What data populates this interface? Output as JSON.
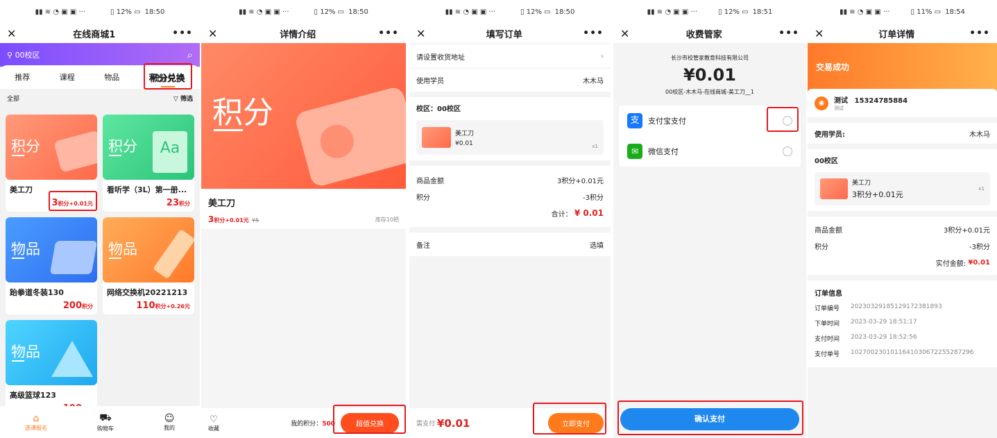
{
  "status": {
    "time1": "18:50",
    "time2": "18:50",
    "time3": "18:50",
    "time4": "18:51",
    "time5": "18:54",
    "battery1": "12%",
    "battery2": "12%",
    "battery3": "12%",
    "battery4": "12%",
    "battery5": "11%"
  },
  "s1": {
    "title": "在线商城1",
    "campus": "00校区",
    "tabs": [
      "推荐",
      "课程",
      "物品",
      "积分兑换"
    ],
    "all": "全部",
    "filter": "筛选",
    "products": [
      {
        "badge": "积分",
        "name": "美工刀",
        "price": "3",
        "unit": "积分+0.01元"
      },
      {
        "badge": "积分",
        "name": "看听学（3L）第一册...",
        "price": "23",
        "unit": "积分"
      },
      {
        "badge": "物品",
        "name": "跆拳道冬装130",
        "price": "200",
        "unit": "积分"
      },
      {
        "badge": "物品",
        "name": "网络交换机20221213",
        "price": "110",
        "unit": "积分+0.26元"
      },
      {
        "badge": "物品",
        "name": "高级篮球123",
        "price": "100",
        "unit": "积分"
      }
    ],
    "bottom": [
      "选课报名",
      "购物车",
      "我的"
    ]
  },
  "s2": {
    "title": "详情介绍",
    "banner": "积分",
    "name": "美工刀",
    "price": "3",
    "unit": "积分+0.01元",
    "orig": "¥5",
    "stock": "库存10把",
    "fav": "收藏",
    "my_points_label": "我的积分：",
    "my_points": "500",
    "btn": "超值兑换"
  },
  "s3": {
    "title": "填写订单",
    "address": "请设置收货地址",
    "student_label": "使用学员",
    "student": "木木马",
    "campus": "校区：00校区",
    "item": "美工刀",
    "item_price": "¥0.01",
    "qty": "x1",
    "amt_label": "商品金额",
    "amt": "3积分+0.01元",
    "pts_label": "积分",
    "pts": "-3积分",
    "total_label": "合计：",
    "total": "¥ 0.01",
    "note_label": "备注",
    "note": "选填",
    "pay_label": "需支付",
    "pay": "¥0.01",
    "btn": "立即支付"
  },
  "s4": {
    "title": "收费管家",
    "company": "长沙市校管家教育科技有限公司",
    "amount": "¥0.01",
    "desc": "00校区-木木马-在线商城-美工刀__1",
    "alipay": "支付宝支付",
    "wechat": "微信支付",
    "btn": "确认支付"
  },
  "s5": {
    "title": "订单详情",
    "banner": "交易成功",
    "contact": "测试",
    "phone": "15324785884",
    "contact_sub": "测试",
    "student_label": "使用学员:",
    "student": "木木马",
    "campus": "00校区",
    "item": "美工刀",
    "item_price": "3积分+0.01元",
    "qty": "x1",
    "amt_label": "商品金额",
    "amt": "3积分+0.01元",
    "pts_label": "积分",
    "pts": "-3积分",
    "paid_label": "实付金额:",
    "paid": "¥0.01",
    "info_title": "订单信息",
    "info": [
      {
        "k": "订单编号",
        "v": "202303291851291723818​93"
      },
      {
        "k": "下单时间",
        "v": "2023-03-29 18:51:17"
      },
      {
        "k": "支付时间",
        "v": "2023-03-29 18:52:56"
      },
      {
        "k": "支付单号",
        "v": "1027002301011641030672255287296"
      }
    ]
  }
}
